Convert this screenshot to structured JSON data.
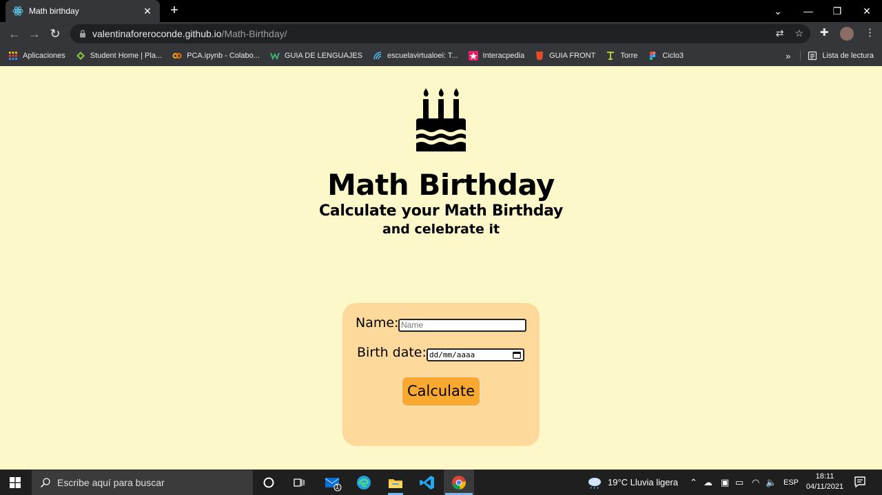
{
  "browser": {
    "tab_title": "Math birthday",
    "url_host": "valentinaforeroconde.github.io",
    "url_path": "/Math-Birthday/",
    "bookmarks": [
      "Aplicaciones",
      "Student Home | Pla...",
      "PCA.ipynb - Colabo...",
      "GUIA DE LENGUAJES",
      "escuelavirtualoei: T...",
      "Interacpedia",
      "GUIA FRONT",
      "Torre",
      "Ciclo3"
    ],
    "reading_list": "Lista de lectura"
  },
  "page": {
    "title": "Math Birthday",
    "subtitle": "Calculate your Math Birthday",
    "tagline": "and celebrate it",
    "form": {
      "name_label": "Name:",
      "name_placeholder": "Name",
      "birth_label": "Birth date:",
      "birth_placeholder": "dd/mm/aaaa",
      "calculate_label": "Calculate"
    },
    "colors": {
      "background": "#fdf8c9",
      "card": "#fdd99b",
      "button": "#f9a830"
    }
  },
  "taskbar": {
    "search_placeholder": "Escribe aquí para buscar",
    "weather": "19°C  Lluvia ligera",
    "language": "ESP",
    "time": "18:11",
    "date": "04/11/2021",
    "mail_badge": "1"
  }
}
